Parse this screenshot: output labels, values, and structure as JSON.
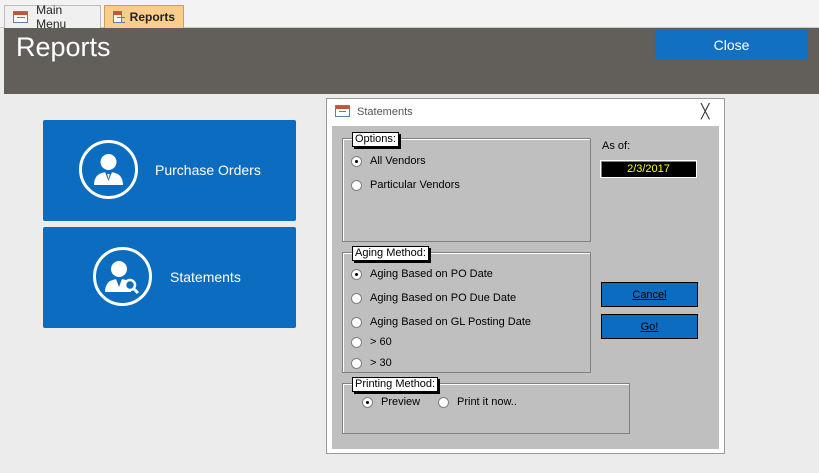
{
  "tabs": [
    {
      "label": "Main Menu",
      "icon": "form-icon",
      "active": false
    },
    {
      "label": "Reports",
      "icon": "form-icon",
      "active": true
    }
  ],
  "header": {
    "title": "Reports",
    "close_label": "Close"
  },
  "buttons": [
    {
      "label": "Purchase Orders",
      "icon": "person-icon"
    },
    {
      "label": "Statements",
      "icon": "person-search-icon"
    }
  ],
  "dialog": {
    "title": "Statements",
    "close_glyph": "╳",
    "options": {
      "legend": "Options:",
      "items": [
        {
          "label": "All Vendors",
          "selected": true
        },
        {
          "label": "Particular Vendors",
          "selected": false
        }
      ]
    },
    "as_of": {
      "label": "As of:",
      "value": "2/3/2017"
    },
    "aging": {
      "legend": "Aging Method:",
      "items": [
        {
          "label": "Aging Based on PO Date",
          "selected": true
        },
        {
          "label": "Aging Based on PO Due Date",
          "selected": false
        },
        {
          "label": "Aging Based on GL Posting Date",
          "selected": false
        },
        {
          "label": "> 60",
          "selected": false
        },
        {
          "label": "> 30",
          "selected": false
        }
      ]
    },
    "printing": {
      "legend": "Printing Method:",
      "items": [
        {
          "label": "Preview",
          "selected": true
        },
        {
          "label": "Print it now..",
          "selected": false
        }
      ]
    },
    "cancel_label": "Cancel",
    "go_label": "Go!"
  },
  "colors": {
    "accent": "#0c6cbf",
    "header_bg": "#625f5a",
    "active_tab": "#f9ce8a",
    "dialog_bg": "#bfbfbf"
  }
}
